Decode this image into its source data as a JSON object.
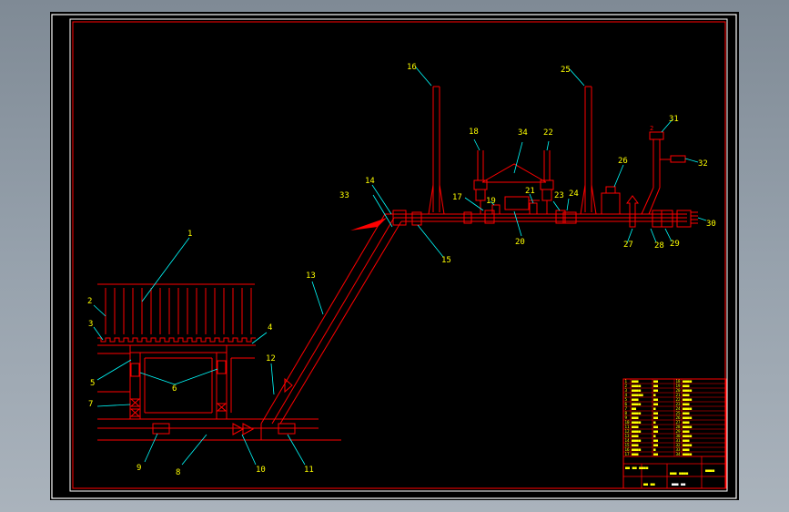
{
  "drawing": {
    "background": "#000000",
    "frame_color": "#ffffff",
    "line_color": "#ff0000",
    "leader_color": "#00ffff",
    "label_color": "#ffff00",
    "callouts": [
      "1",
      "2",
      "3",
      "4",
      "5",
      "6",
      "7",
      "8",
      "9",
      "10",
      "11",
      "12",
      "13",
      "14",
      "15",
      "16",
      "17",
      "18",
      "19",
      "20",
      "21",
      "22",
      "23",
      "24",
      "25",
      "26",
      "27",
      "28",
      "29",
      "30",
      "31",
      "32",
      "33",
      "34"
    ],
    "small_mark": "2"
  },
  "title_block": {
    "parts_rows": [
      [
        "1",
        "■■■",
        "■■",
        "18",
        "■■■■"
      ],
      [
        "2",
        "■■■■",
        "■■",
        "19",
        "■■■"
      ],
      [
        "3",
        "■■■■",
        "■■",
        "20",
        "■■■■"
      ],
      [
        "4",
        "■■■■■",
        "■",
        "21",
        "■■■"
      ],
      [
        "5",
        "■■■",
        "■■",
        "22",
        "■■■■"
      ],
      [
        "6",
        "■■■■",
        "■■",
        "23",
        "■■■"
      ],
      [
        "7",
        "■■",
        "■",
        "24",
        "■■■■"
      ],
      [
        "8",
        "■■■■",
        "■■",
        "25",
        "■■■"
      ],
      [
        "9",
        "■■■",
        "■■",
        "26",
        "■■■■"
      ],
      [
        "10",
        "■■■■",
        "■",
        "27",
        "■■■"
      ],
      [
        "11",
        "■■■",
        "■■",
        "28",
        "■■■■"
      ],
      [
        "12",
        "■■■■",
        "■■",
        "29",
        "■■■"
      ],
      [
        "13",
        "■■■",
        "■",
        "30",
        "■■■■"
      ],
      [
        "14",
        "■■■■",
        "■■",
        "31",
        "■■■"
      ],
      [
        "15",
        "■■■",
        "■■",
        "32",
        "■■■■"
      ],
      [
        "16",
        "■■■■",
        "■",
        "33",
        "■■■"
      ],
      [
        "17",
        "■■■",
        "■■",
        "34",
        "■■■■"
      ]
    ],
    "block_a": "■■ ■■ ■■■■",
    "block_b": "■■■ ■■■■",
    "block_c": "■■■■",
    "block_d": "■■ ■■",
    "block_e": "■■■ ■■"
  }
}
